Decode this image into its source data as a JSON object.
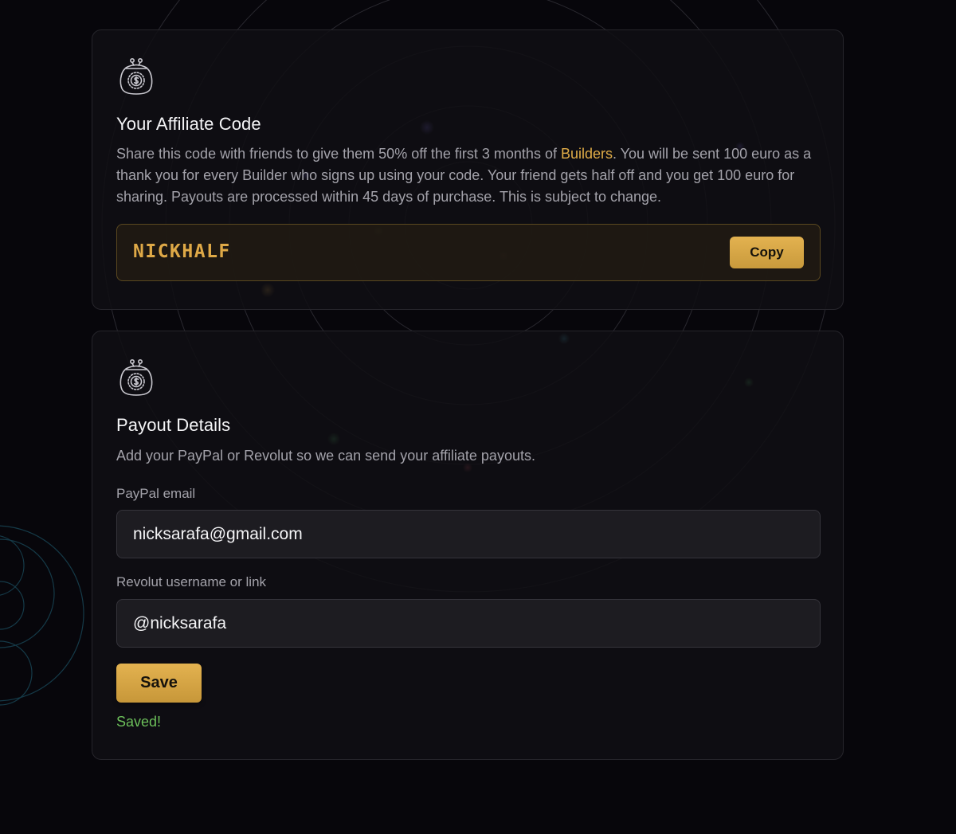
{
  "colors": {
    "background": "#07060b",
    "card": "#100f13",
    "accent_gold": "#e0ac47",
    "success_green": "#6cbf5a",
    "text_muted": "#a3a2aa"
  },
  "affiliate": {
    "icon": "money-bag-icon",
    "title": "Your Affiliate Code",
    "desc_before": "Share this code with friends to give them 50% off the first 3 months of ",
    "desc_link": "Builders",
    "desc_after": ". You will be sent 100 euro as a thank you for every Builder who signs up using your code. Your friend gets half off and you get 100 euro for sharing. Payouts are processed within 45 days of purchase. This is subject to change.",
    "code": "NICKHALF",
    "copy_label": "Copy"
  },
  "payout": {
    "icon": "money-bag-icon",
    "title": "Payout Details",
    "description": "Add your PayPal or Revolut so we can send your affiliate payouts.",
    "paypal_label": "PayPal email",
    "paypal_value": "nicksarafa@gmail.com",
    "revolut_label": "Revolut username or link",
    "revolut_value": "@nicksarafa",
    "save_label": "Save",
    "status": "Saved!"
  }
}
